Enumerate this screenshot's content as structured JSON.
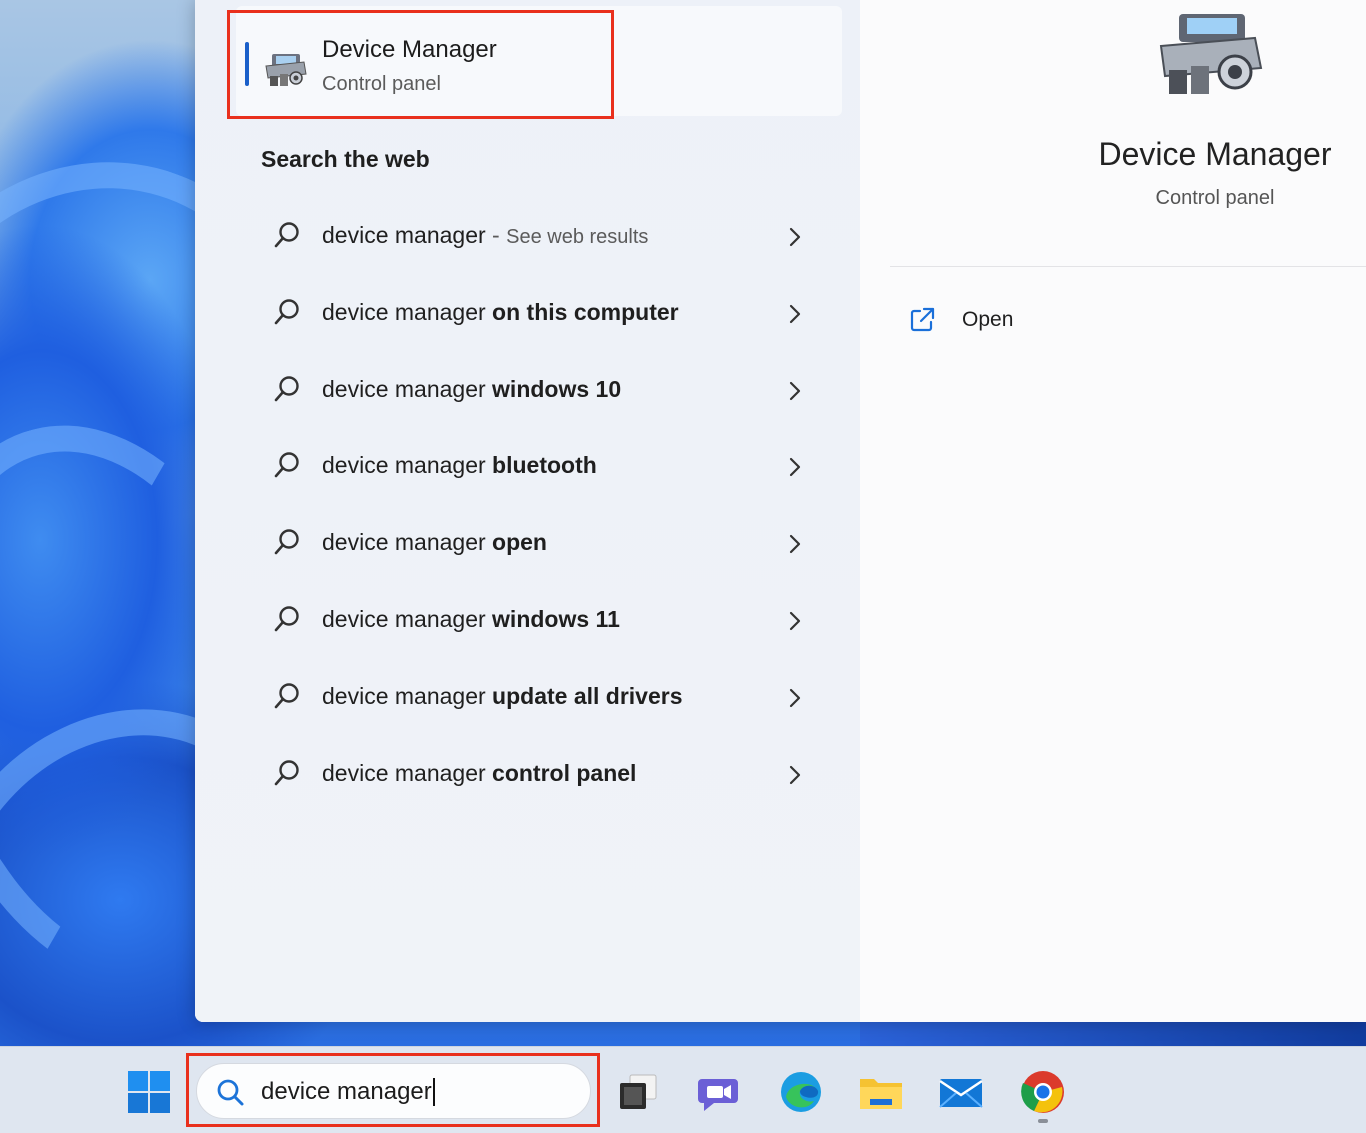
{
  "best_match": {
    "title": "Device Manager",
    "subtitle": "Control panel"
  },
  "web_section": {
    "header": "Search the web",
    "items": [
      {
        "prefix": "device manager",
        "bold": "",
        "hint": "See web results"
      },
      {
        "prefix": "device manager ",
        "bold": "on this computer",
        "hint": ""
      },
      {
        "prefix": "device manager ",
        "bold": "windows 10",
        "hint": ""
      },
      {
        "prefix": "device manager ",
        "bold": "bluetooth",
        "hint": ""
      },
      {
        "prefix": "device manager ",
        "bold": "open",
        "hint": ""
      },
      {
        "prefix": "device manager ",
        "bold": "windows 11",
        "hint": ""
      },
      {
        "prefix": "device manager ",
        "bold": "update all drivers",
        "hint": ""
      },
      {
        "prefix": "device manager ",
        "bold": "control panel",
        "hint": ""
      }
    ]
  },
  "detail_pane": {
    "title": "Device Manager",
    "subtitle": "Control panel",
    "actions": [
      {
        "label": "Open",
        "icon": "open-external-icon"
      }
    ]
  },
  "taskbar": {
    "search_query": "device manager",
    "icons": [
      "windows-start-icon",
      "task-view-icon",
      "teams-chat-icon",
      "edge-icon",
      "file-explorer-icon",
      "mail-icon",
      "chrome-icon"
    ]
  },
  "colors": {
    "accent": "#1a5fc9",
    "highlight_box": "#e9301d"
  }
}
